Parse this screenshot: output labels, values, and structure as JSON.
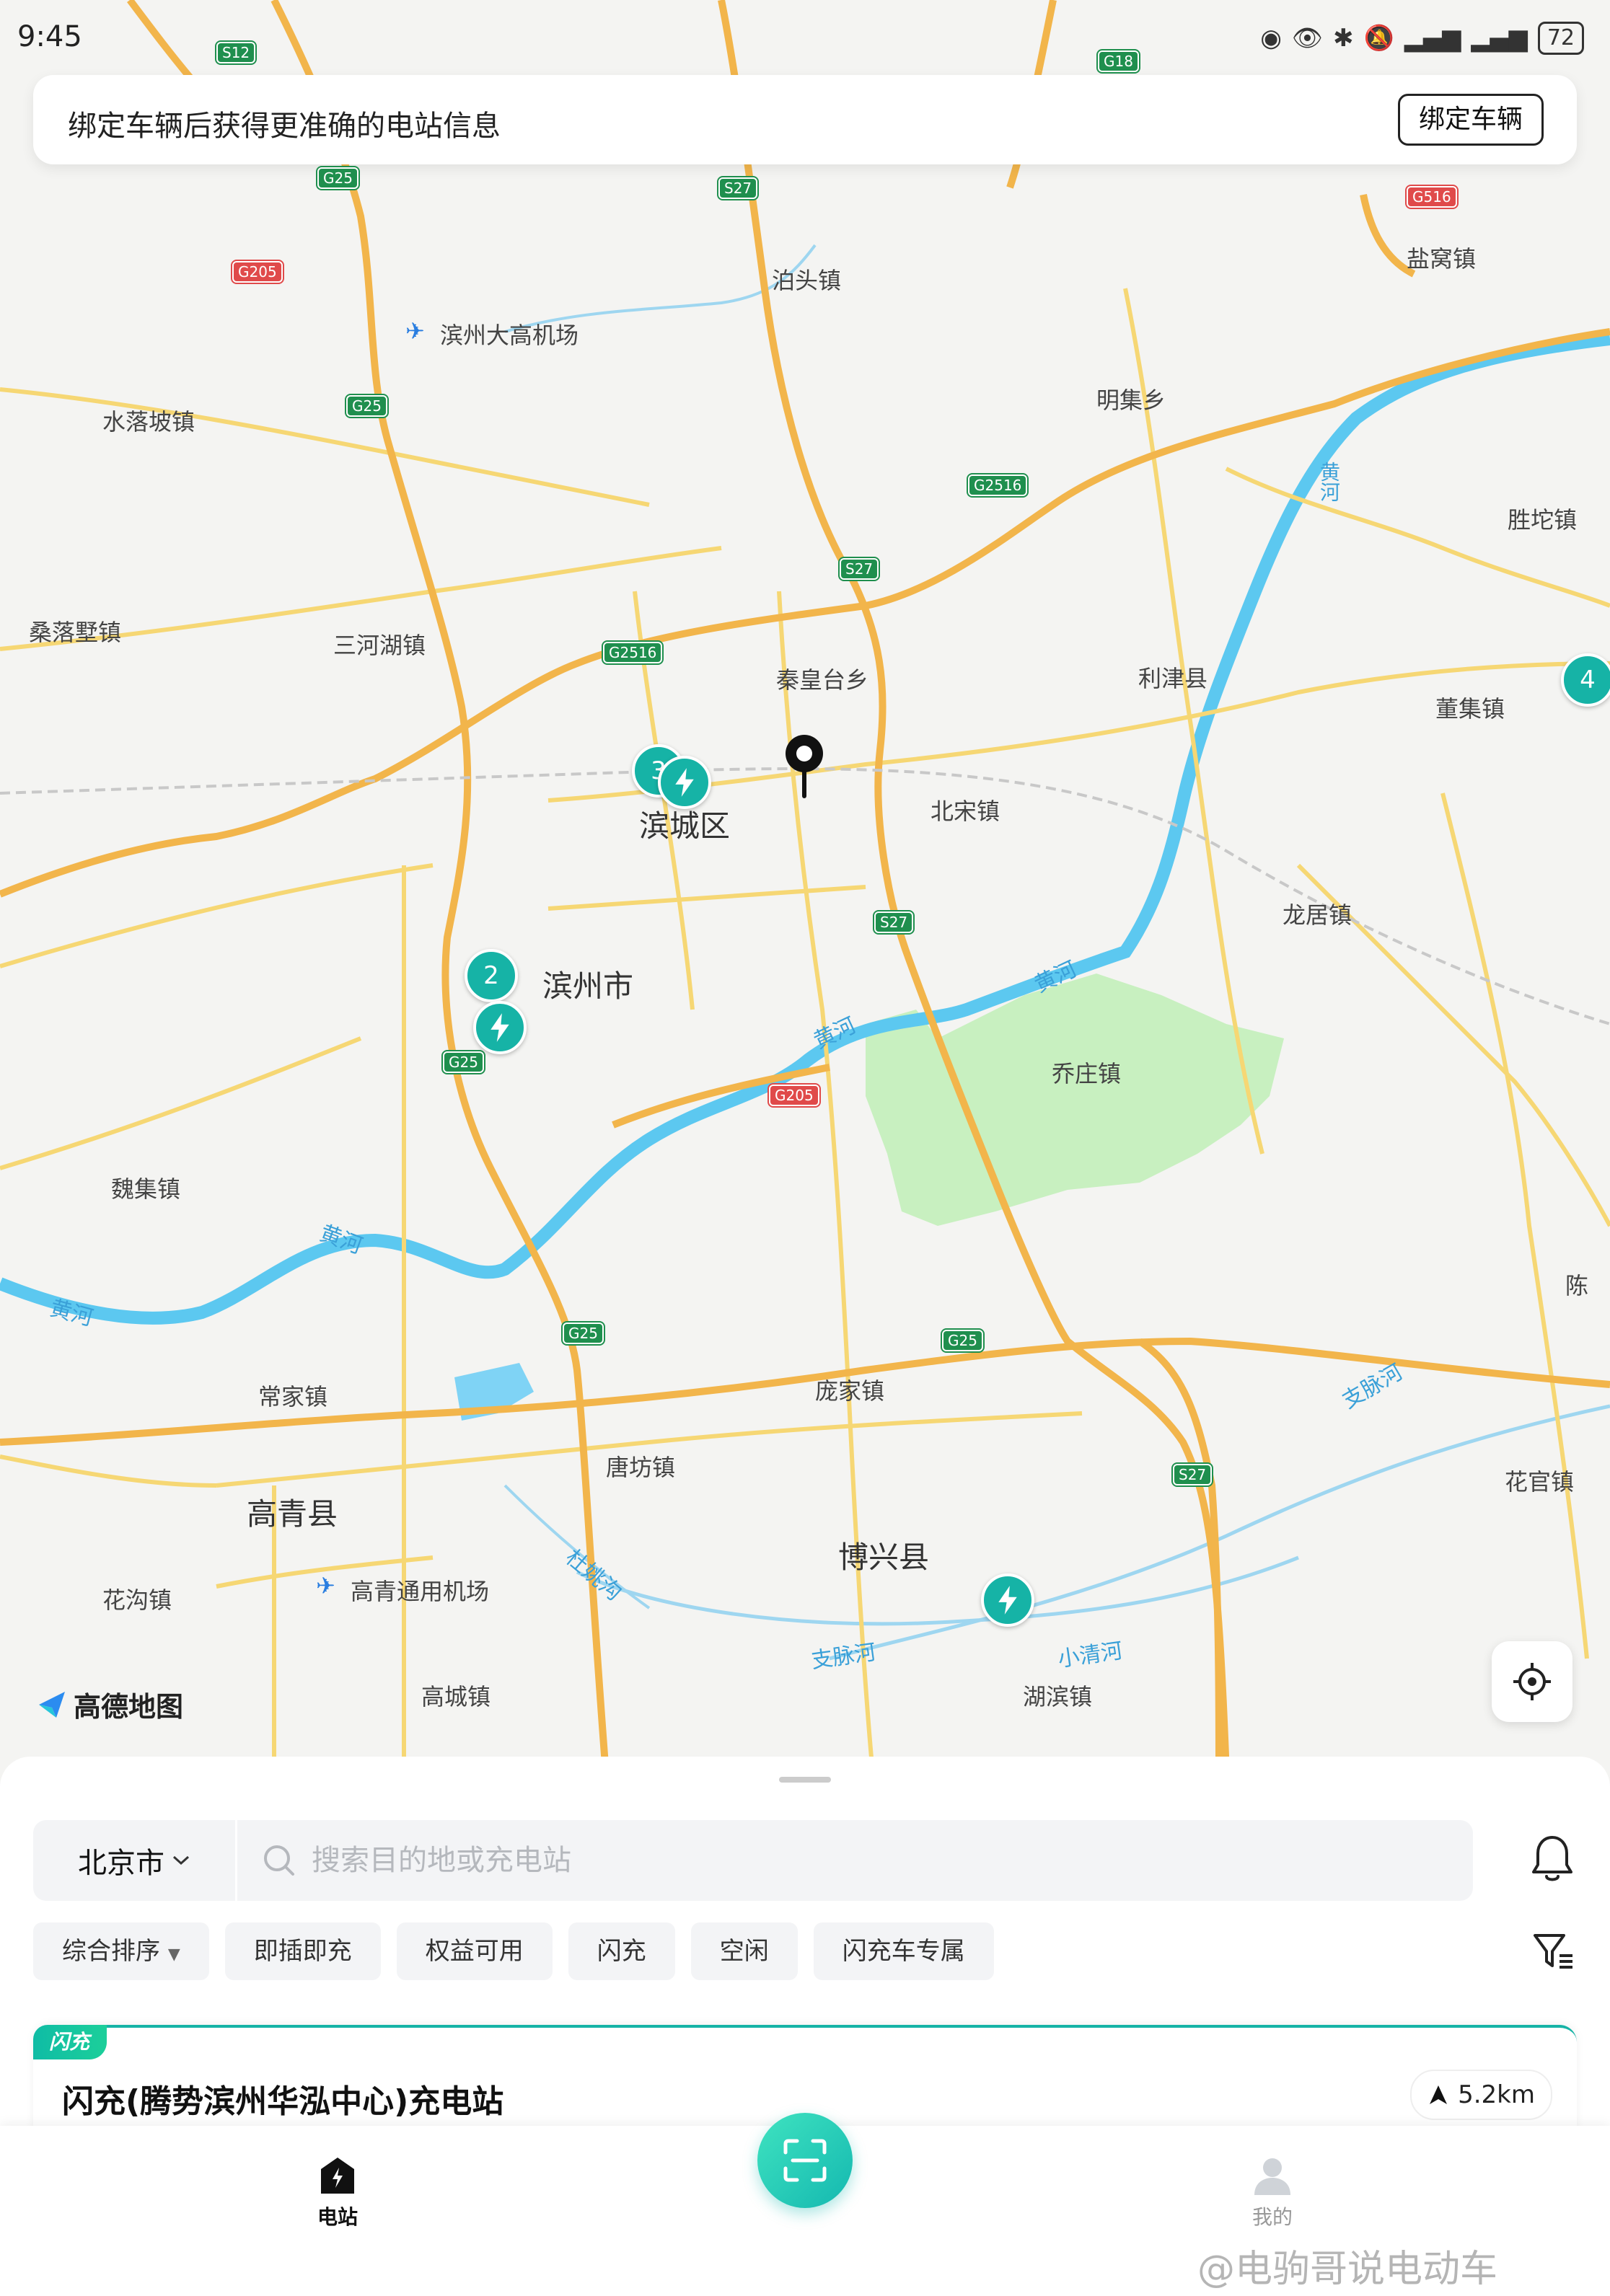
{
  "status_bar": {
    "time": "9:45",
    "battery": "72"
  },
  "bind_banner": {
    "message": "绑定车辆后获得更准确的电站信息",
    "button_label": "绑定车辆"
  },
  "map": {
    "places": {
      "botou": "泊头镇",
      "yanwo": "盐窝镇",
      "airport_binzhou": "滨州大高机场",
      "shuiluopo": "水落坡镇",
      "mingji": "明集乡",
      "shengtuo": "胜坨镇",
      "sangluoshu": "桑落墅镇",
      "sanhehu": "三河湖镇",
      "qinhuangtai": "秦皇台乡",
      "lijin": "利津县",
      "dongji": "董集镇",
      "bincheng": "滨城区",
      "beisong": "北宋镇",
      "longju": "龙居镇",
      "binzhou_city": "滨州市",
      "qiaozhuang": "乔庄镇",
      "weiji": "魏集镇",
      "chen": "陈",
      "changjia": "常家镇",
      "pangjia": "庞家镇",
      "huaguan": "花官镇",
      "tangfang": "唐坊镇",
      "gaoqing": "高青县",
      "boxing": "博兴县",
      "huagou": "花沟镇",
      "airport_gaoqing": "高青通用机场",
      "gaocheng": "高城镇",
      "hubin": "湖滨镇"
    },
    "rivers": {
      "huanghe_1": "黄河",
      "huanghe_2": "黄河",
      "huanghe_3": "黄河",
      "huanghe_4": "黄河",
      "huanghe_5": "黄河",
      "huanghe_6": "黄河",
      "zhimai_1": "支脉河",
      "zhimai_2": "支脉河",
      "duyao": "杜姚沟",
      "xiaoqing": "小清河"
    },
    "roads": {
      "s12": "S12",
      "g18": "G18",
      "g25_a": "G25",
      "s27_a": "S27",
      "g516": "G516",
      "g205_a": "G205",
      "g25_b": "G25",
      "g2516_a": "G2516",
      "s27_b": "S27",
      "g2516_b": "G2516",
      "s27_c": "S27",
      "g25_c": "G25",
      "g205_b": "G205",
      "g25_d": "G25",
      "g25_e": "G25",
      "s27_d": "S27"
    },
    "station_markers": {
      "cluster_2": "2",
      "cluster_4": "4",
      "cluster_3": "3"
    },
    "provider_logo": "高德地图"
  },
  "panel": {
    "city": "北京市",
    "search_placeholder": "搜索目的地或充电站",
    "chips": [
      "综合排序",
      "即插即充",
      "权益可用",
      "闪充",
      "空闲",
      "闪充车专属"
    ],
    "station": {
      "tag": "闪充",
      "name": "闪充(腾势滨州华泓中心)充电站",
      "distance": "5.2km"
    }
  },
  "tabbar": {
    "stations": "电站",
    "mine": "我的"
  },
  "watermark": "@电驹哥说电动车",
  "colors": {
    "accent": "#16b3a6",
    "road_orange": "#f2b54b",
    "road_yellow": "#f6d774",
    "river": "#5cc8f0",
    "park": "#c8f0c0"
  }
}
